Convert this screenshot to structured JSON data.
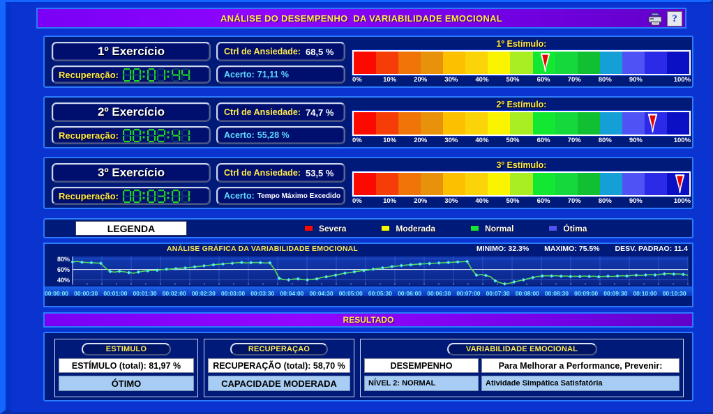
{
  "window": {
    "title": "ANÁLISE DO DESEMPENHO  DA VARIABILIDADE EMOCIONAL",
    "print_icon": "printer-icon",
    "help_icon": "help-icon",
    "help_glyph": "?"
  },
  "colors": {
    "background": "#0b33cf",
    "panel": "#001a7a",
    "panel_border": "#2a7bff",
    "title_gradient_start": "#7a00f5",
    "title_text": "#ffe94d",
    "label_yellow": "#ffe94d",
    "value_white": "#ffffff",
    "acerto_cyan": "#5fd8ff",
    "lcd_green": "#21d421",
    "marker_red": "#e60000",
    "chart_line": "#56d94a",
    "chart_point": "#58e8f2"
  },
  "gauge_segments": [
    "#fc0a00",
    "#f63c07",
    "#f07408",
    "#e8920c",
    "#fcc000",
    "#fad408",
    "#fbf400",
    "#a8ee22",
    "#12e832",
    "#14d83c",
    "#10c032",
    "#149fd6",
    "#4f52f4",
    "#2b2ae8",
    "#0c10c4"
  ],
  "gauge_scale": [
    "0%",
    "10%",
    "20%",
    "30%",
    "40%",
    "50%",
    "60%",
    "70%",
    "80%",
    "90%",
    "100%"
  ],
  "exercises": [
    {
      "title": "1º Exercício",
      "recovery_label": "Recuperação:",
      "recovery_time": "00:01:44",
      "ctrl_label": "Ctrl de Ansiedade:",
      "ctrl_value": "68,5 %",
      "acerto_label": "Acerto:",
      "acerto_value": "71,11 %",
      "acerto_small": false,
      "stimulus_title": "1º Estímulo:",
      "marker_percent": 57
    },
    {
      "title": "2º Exercício",
      "recovery_label": "Recuperação:",
      "recovery_time": "00:02:41",
      "ctrl_label": "Ctrl de Ansiedade:",
      "ctrl_value": "74,7 %",
      "acerto_label": "Acerto:",
      "acerto_value": "55,28 %",
      "acerto_small": false,
      "stimulus_title": "2º Estímulo:",
      "marker_percent": 89
    },
    {
      "title": "3º Exercício",
      "recovery_label": "Recuperação:",
      "recovery_time": "00:03:01",
      "ctrl_label": "Ctrl de Ansiedade:",
      "ctrl_value": "53,5 %",
      "acerto_label": "Acerto:",
      "acerto_value": "Tempo Máximo Excedido",
      "acerto_small": true,
      "stimulus_title": "3º Estímulo:",
      "marker_percent": 97
    }
  ],
  "legend": {
    "box_label": "LEGENDA",
    "items": [
      {
        "label": "Severa",
        "color": "#fc0a00"
      },
      {
        "label": "Moderada",
        "color": "#fbf400"
      },
      {
        "label": "Normal",
        "color": "#12e832"
      },
      {
        "label": "Ótima",
        "color": "#4f52f4"
      }
    ]
  },
  "resultado": {
    "banner": "RESULTADO",
    "estimulo": {
      "pill": "ESTIMULO",
      "total": "ESTÍMULO (total): 81,97 %",
      "verdict": "ÓTIMO"
    },
    "recuperacao": {
      "pill": "RECUPERAÇAO",
      "total": "RECUPERAÇÃO (total): 58,70 %",
      "verdict": "CAPACIDADE MODERADA"
    },
    "variabilidade": {
      "pill": "VARIABILIDADE EMOCIONAL",
      "col1_header": "DESEMPENHO",
      "col2_header": "Para Melhorar a Performance, Prevenir:",
      "col1_value": "NÍVEL 2: NORMAL",
      "col2_value": "Atividade Simpática Satisfatória"
    }
  },
  "chart_data": {
    "type": "line",
    "title": "ANÁLISE GRÁFICA DA VARIABILIDADE EMOCIONAL",
    "xlabel": "",
    "ylabel": "",
    "ylim": [
      30,
      85
    ],
    "yticks": [
      40,
      60,
      80
    ],
    "ytick_labels": [
      "40%",
      "60%",
      "80%"
    ],
    "grid": true,
    "legend_position": "none",
    "stats": {
      "minimo_label": "MINIMO: 32.3%",
      "maximo_label": "MAXIMO: 75.5%",
      "desvio_label": "DESV. PADRAO: 11.4",
      "minimo": 32.3,
      "maximo": 75.5,
      "desv_padrao": 11.4
    },
    "x_tick_labels": [
      "00:00:00",
      "00:00:30",
      "00:01:00",
      "00:01:30",
      "00:02:00",
      "00:02:30",
      "00:03:00",
      "00:03:30",
      "00:04:00",
      "00:04:30",
      "00:05:00",
      "00:05:30",
      "00:06:00",
      "00:06:30",
      "00:07:00",
      "00:07:30",
      "00:08:00",
      "00:08:30",
      "00:09:00",
      "00:09:30",
      "00:10:00",
      "00:10:30"
    ],
    "x_range": [
      "00:00:00",
      "00:10:30"
    ],
    "series": [
      {
        "name": "Variabilidade Emocional",
        "color": "#56d94a",
        "marker_color": "#58e8f2",
        "values": [
          74.5,
          75.5,
          74.0,
          73.5,
          73.0,
          72.5,
          72.0,
          63.0,
          56.0,
          55.0,
          56.5,
          55.5,
          54.0,
          53.0,
          55.0,
          56.5,
          57.5,
          58.0,
          58.5,
          59.5,
          60.5,
          61.0,
          61.5,
          62.5,
          63.0,
          64.0,
          65.0,
          66.0,
          67.0,
          68.0,
          69.0,
          70.0,
          70.5,
          71.5,
          72.0,
          73.0,
          73.5,
          72.5,
          73.0,
          73.5,
          73.0,
          72.5,
          72.8,
          60.0,
          43.0,
          40.5,
          40.0,
          41.5,
          42.0,
          40.5,
          40.0,
          41.0,
          42.0,
          44.5,
          46.0,
          47.5,
          49.0,
          51.0,
          53.0,
          54.0,
          55.5,
          57.0,
          58.0,
          59.0,
          60.5,
          62.0,
          63.0,
          64.0,
          65.5,
          66.5,
          67.5,
          68.5,
          69.0,
          70.0,
          70.5,
          71.0,
          71.5,
          72.0,
          72.5,
          73.0,
          73.5,
          74.0,
          74.5,
          75.0,
          75.5,
          60.0,
          49.0,
          50.0,
          48.5,
          46.0,
          38.0,
          34.5,
          32.3,
          33.5,
          36.0,
          38.0,
          40.0,
          42.5,
          44.5,
          46.5,
          47.5,
          48.0,
          47.5,
          48.0,
          47.0,
          47.5,
          46.5,
          47.0,
          46.5,
          47.5,
          46.5,
          47.0,
          46.0,
          46.5,
          47.0,
          46.5,
          47.5,
          48.0,
          47.5,
          48.5,
          49.0,
          48.5,
          49.5,
          50.0,
          49.5,
          50.5,
          51.5,
          52.0,
          51.0,
          51.5,
          50.5,
          49.0
        ]
      }
    ]
  }
}
